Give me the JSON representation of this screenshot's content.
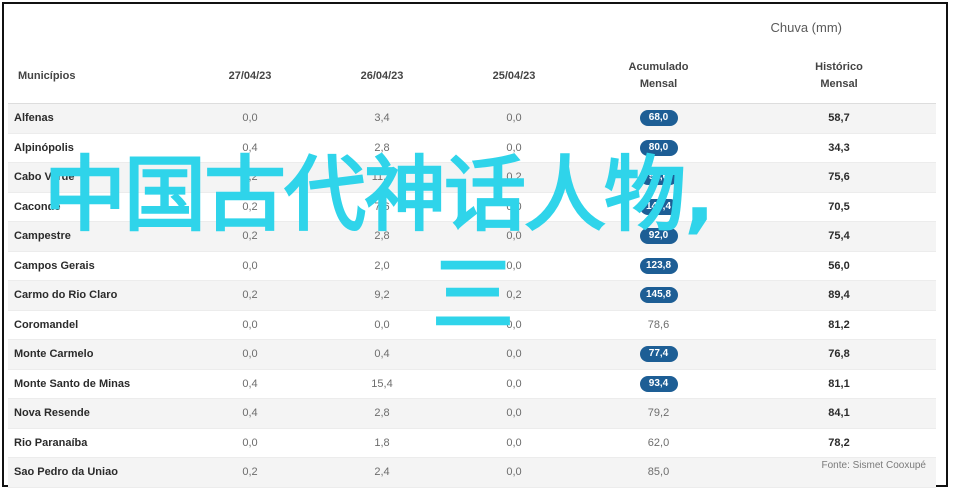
{
  "table": {
    "unit_title": "Chuva (mm)",
    "headers": [
      "Municípios",
      "27/04/23",
      "26/04/23",
      "25/04/23",
      "Acumulado\nMensal",
      "Histórico\nMensal"
    ],
    "rows": [
      {
        "name": "Alfenas",
        "d27": "0,0",
        "d26": "3,4",
        "d25": "0,0",
        "acum": "68,0",
        "pill": true,
        "hist": "58,7"
      },
      {
        "name": "Alpinópolis",
        "d27": "0,4",
        "d26": "2,8",
        "d25": "0,0",
        "acum": "80,0",
        "pill": true,
        "hist": "34,3"
      },
      {
        "name": "Cabo Verde",
        "d27": "0,2",
        "d26": "11,4",
        "d25": "0,2",
        "acum": "94,6",
        "pill": true,
        "hist": "75,6"
      },
      {
        "name": "Cacondé",
        "d27": "0,2",
        "d26": "7,6",
        "d25": "0,0",
        "acum": "140,4",
        "pill": true,
        "hist": "70,5"
      },
      {
        "name": "Campestre",
        "d27": "0,2",
        "d26": "2,8",
        "d25": "0,0",
        "acum": "92,0",
        "pill": true,
        "hist": "75,4"
      },
      {
        "name": "Campos Gerais",
        "d27": "0,0",
        "d26": "2,0",
        "d25": "0,0",
        "acum": "123,8",
        "pill": true,
        "hist": "56,0"
      },
      {
        "name": "Carmo do Rio Claro",
        "d27": "0,2",
        "d26": "9,2",
        "d25": "0,2",
        "acum": "145,8",
        "pill": true,
        "hist": "89,4"
      },
      {
        "name": "Coromandel",
        "d27": "0,0",
        "d26": "0,0",
        "d25": "0,0",
        "acum": "78,6",
        "pill": false,
        "hist": "81,2"
      },
      {
        "name": "Monte Carmelo",
        "d27": "0,0",
        "d26": "0,4",
        "d25": "0,0",
        "acum": "77,4",
        "pill": true,
        "hist": "76,8"
      },
      {
        "name": "Monte Santo de Minas",
        "d27": "0,4",
        "d26": "15,4",
        "d25": "0,0",
        "acum": "93,4",
        "pill": true,
        "hist": "81,1"
      },
      {
        "name": "Nova Resende",
        "d27": "0,4",
        "d26": "2,8",
        "d25": "0,0",
        "acum": "79,2",
        "pill": false,
        "hist": "84,1"
      },
      {
        "name": "Rio Paranaíba",
        "d27": "0,0",
        "d26": "1,8",
        "d25": "0,0",
        "acum": "62,0",
        "pill": false,
        "hist": "78,2"
      },
      {
        "name": "Sao Pedro da Uniao",
        "d27": "0,2",
        "d26": "2,4",
        "d25": "0,0",
        "acum": "85,0",
        "pill": false,
        "hist": ""
      }
    ],
    "source": "Fonte: Sismet Cooxupé"
  },
  "overlay": {
    "title": "中国古代神话人物,",
    "subtitle": "三"
  },
  "colors": {
    "pill": "#1d5e95",
    "overlay_text": "#2fd4ea",
    "row_stripe": "#f4f4f4"
  }
}
